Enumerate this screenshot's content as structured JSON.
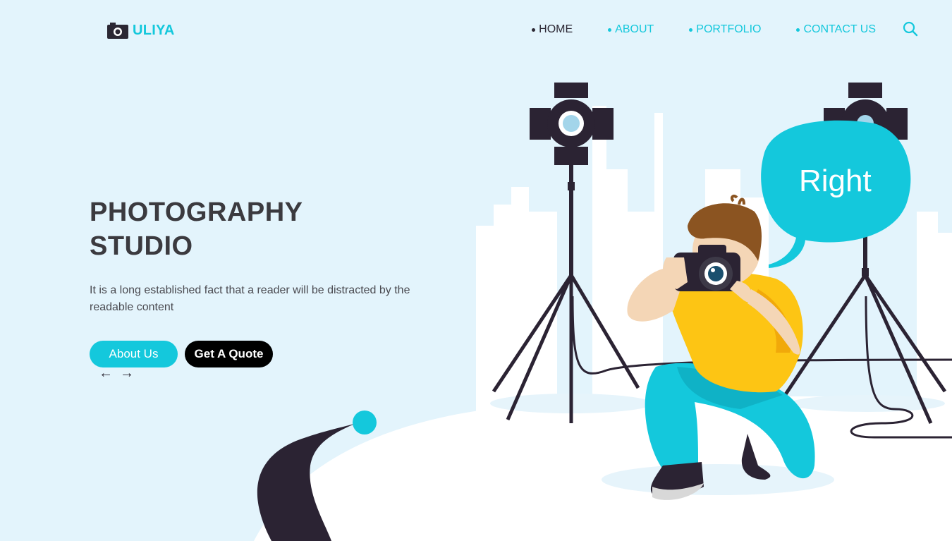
{
  "brand": {
    "name": "ULIYA",
    "icon": "camera-icon"
  },
  "nav": {
    "items": [
      {
        "label": "HOME",
        "active": true
      },
      {
        "label": "ABOUT",
        "active": false
      },
      {
        "label": "PORTFOLIO",
        "active": false
      },
      {
        "label": "CONTACT US",
        "active": false
      }
    ],
    "search_icon": "search-icon"
  },
  "hero": {
    "title_line1": "PHOTOGRAPHY",
    "title_line2": "STUDIO",
    "text": "It is a long established fact that a reader will be distracted by the readable content",
    "about_button": "About Us",
    "quote_button": "Get A Quote",
    "prev_arrow": "←",
    "next_arrow": "→"
  },
  "bubble": {
    "text": "Right"
  },
  "colors": {
    "accent": "#14c8dc",
    "dark": "#2b2733",
    "background": "#e3f4fc",
    "shirt": "#fdc514"
  }
}
